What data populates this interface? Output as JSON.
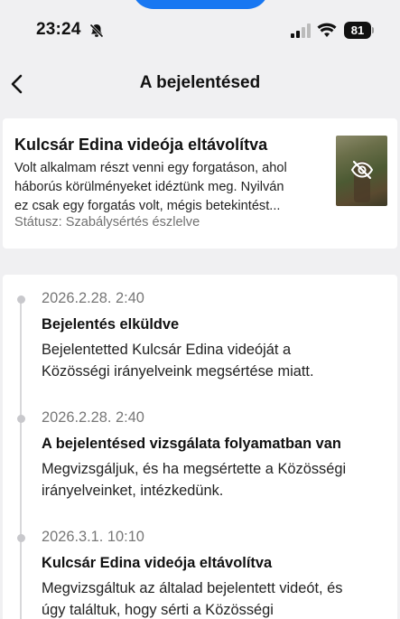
{
  "status_bar": {
    "time": "23:24",
    "battery": "81"
  },
  "header": {
    "title": "A bejelentésed"
  },
  "report_card": {
    "title": "Kulcsár Edina videója eltávolítva",
    "description_lines": [
      "Volt alkalmam részt venni egy forgatáson, ahol",
      "háborús körülményeket idéztünk meg. Nyilván",
      "ez csak egy forgatás volt, mégis betekintést..."
    ],
    "status": "Státusz: Szabálysértés észlelve"
  },
  "timeline": [
    {
      "time": "2026.2.28. 2:40",
      "heading": "Bejelentés elküldve",
      "body_lines": [
        "Bejelentetted Kulcsár Edina videóját a",
        "Közösségi irányelveink megsértése miatt."
      ]
    },
    {
      "time": "2026.2.28. 2:40",
      "heading": "A bejelentésed vizsgálata folyamatban van",
      "body_lines": [
        "Megvizsgáljuk, és ha megsértette a Közösségi",
        "irányelveinket, intézkedünk."
      ]
    },
    {
      "time": "2026.3.1. 10:10",
      "heading": "Kulcsár Edina videója eltávolítva",
      "body_lines": [
        "Megvizsgáltuk az általad bejelentett videót, és",
        "úgy találtuk, hogy sérti a Közösségi"
      ]
    }
  ],
  "icons": {
    "back": "chevron-left-icon",
    "bell": "bell-slash-icon",
    "signal": "cellular-signal-icon",
    "wifi": "wifi-icon",
    "battery": "battery-icon",
    "hidden": "eye-slash-icon"
  },
  "colors": {
    "accent": "#1877f2",
    "background": "#f0f0f2",
    "muted_text": "#777777"
  }
}
